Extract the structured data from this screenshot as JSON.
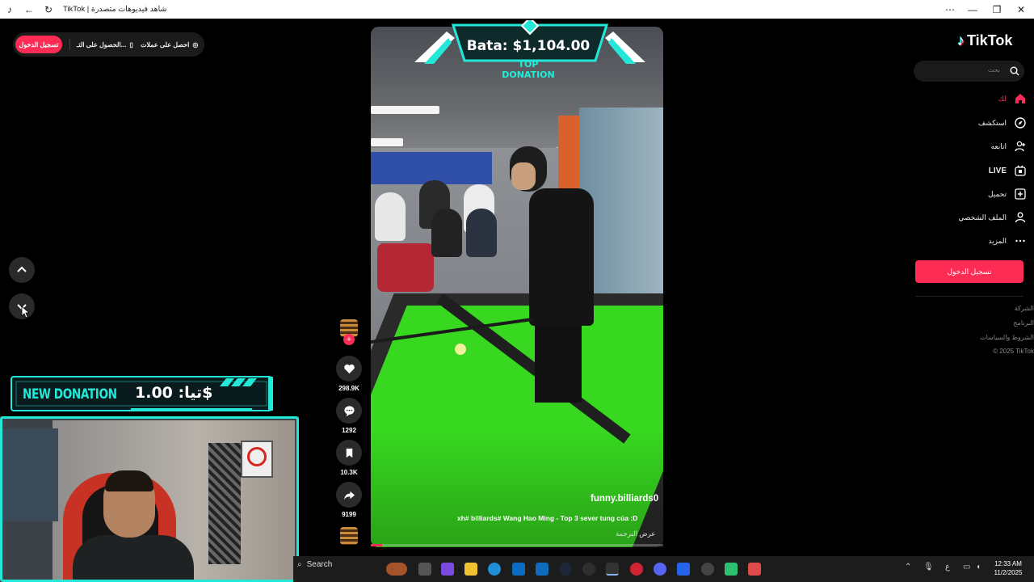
{
  "window": {
    "title": "TikTok | شاهد فيديوهات متصدرة",
    "controls": {
      "minimize": "—",
      "maximize": "❐",
      "close": "✕",
      "more": "⋯"
    }
  },
  "header": {
    "login_pill": "تسجيل الدخول",
    "get_app": "الحصول على التـ...",
    "get_coins": "احصل على عملات"
  },
  "video": {
    "top_donation_name": "Bata: $1,104.00",
    "top_donation_label": "TOP DONATION",
    "username": "funny.billiards0",
    "description": "xh# billiards# Wang Hao Ming - Top 3 sever tung của :D",
    "translate": "عرض الترجمة",
    "progress_pct": 4
  },
  "actions": {
    "likes": "298.9K",
    "comments": "1292",
    "saves": "10.3K",
    "shares": "9199"
  },
  "sidebar": {
    "logo": "TikTok",
    "search_placeholder": "بحث",
    "items": [
      {
        "label": "لك",
        "icon": "home-icon",
        "active": true
      },
      {
        "label": "استكشف",
        "icon": "explore-icon"
      },
      {
        "label": "اتابعه",
        "icon": "following-icon"
      },
      {
        "label": "LIVE",
        "icon": "live-icon"
      },
      {
        "label": "تحميل",
        "icon": "upload-icon"
      },
      {
        "label": "الملف الشخصي",
        "icon": "profile-icon"
      },
      {
        "label": "المزيد",
        "icon": "more-icon"
      }
    ],
    "login_button": "تسجيل الدخول",
    "footer": [
      "الشركة",
      "البرنامج",
      "الشروط والسياسات",
      "© 2025 TikTok"
    ]
  },
  "overlay": {
    "new_donation_label": "NEW DONATION",
    "new_donation_amount": "تيا: 1.00$"
  },
  "taskbar": {
    "search": "Search",
    "time": "12:33 AM",
    "date": "11/2/2025",
    "lang": "ع"
  },
  "colors": {
    "accent": "#fe2c55",
    "overlay_cyan": "#23e8d8",
    "felt": "#37d81f"
  }
}
